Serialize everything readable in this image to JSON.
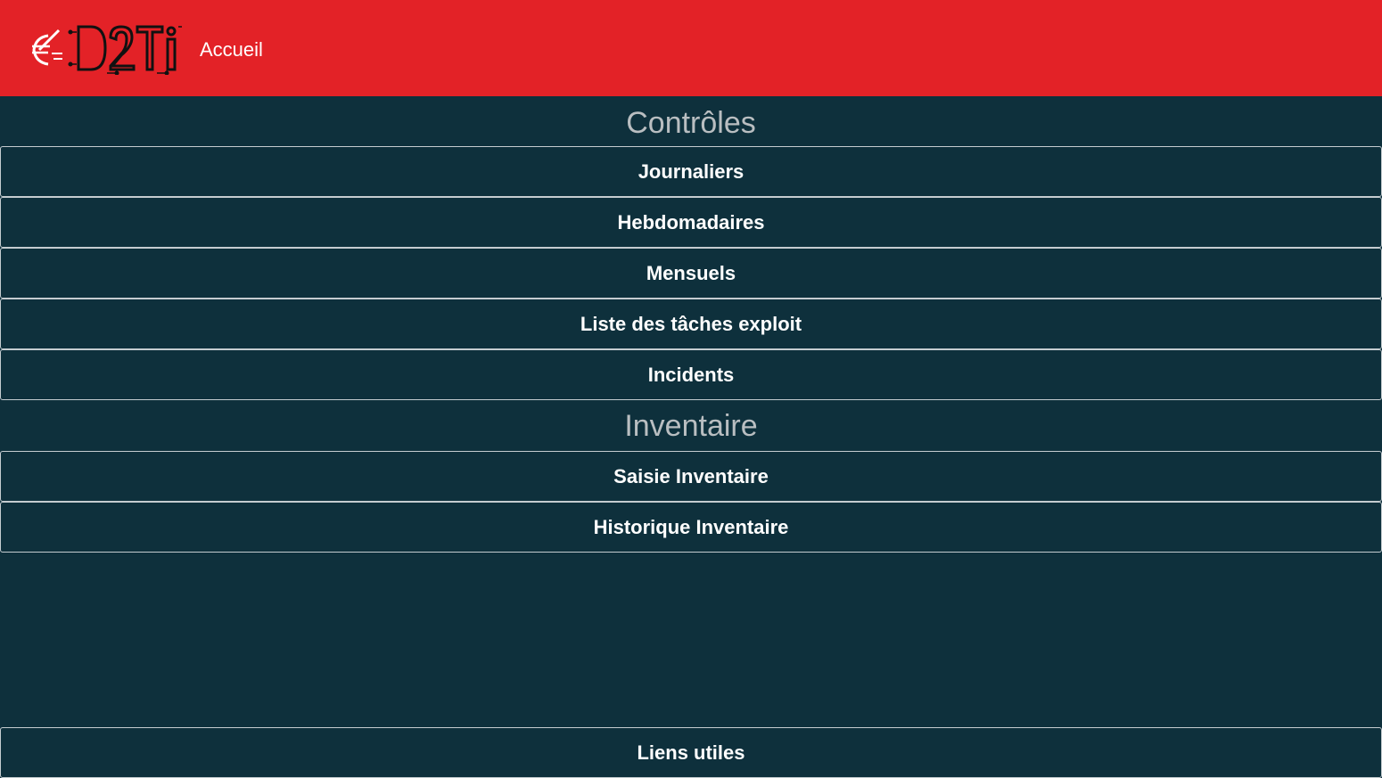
{
  "header": {
    "logo_text": "D2TI",
    "home_label": "Accueil",
    "background_color": "#e32227"
  },
  "sections": [
    {
      "title": "Contrôles",
      "items": [
        {
          "label": "Journaliers"
        },
        {
          "label": "Hebdomadaires"
        },
        {
          "label": "Mensuels"
        },
        {
          "label": "Liste des tâches exploit"
        },
        {
          "label": "Incidents"
        }
      ]
    },
    {
      "title": "Inventaire",
      "items": [
        {
          "label": "Saisie Inventaire"
        },
        {
          "label": "Historique Inventaire"
        }
      ]
    }
  ],
  "footer": {
    "links_label": "Liens utiles"
  },
  "colors": {
    "panel_background": "#0e303c",
    "section_title": "#b9bec1",
    "item_text": "#ffffff",
    "item_border": "#c5ccd0"
  },
  "icons": {
    "logo": "euro-circuit-logo-icon"
  }
}
